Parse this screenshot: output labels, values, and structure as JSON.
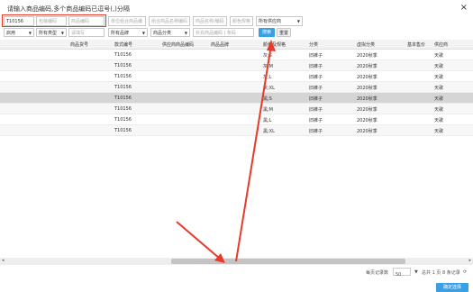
{
  "dialog": {
    "title": "请输入商品编码,多个商品编码已逗号(,)分隔",
    "close_icon": "×"
  },
  "filters": {
    "code_input_value": "T10156",
    "spec_code_placeholder": "包装编码",
    "product_code_placeholder": "商品编码",
    "fields": [
      "单位组合商品编码",
      "组合商品名称编码",
      "商品名称/编码",
      "颜色规格"
    ],
    "supplier_select": "所有供应商",
    "status_select": "启用",
    "all_types_select": "所有类型",
    "enterprise_placeholder": "请填写",
    "brand_select": "所有品牌",
    "category_select": "商品分类",
    "goods_search_placeholder": "补充商品编码 | 条码",
    "search_button": "搜索",
    "reset_button": "重置"
  },
  "table": {
    "headers": [
      "商品货号",
      "款式编号",
      "供应商商品编码",
      "商品品牌",
      "颜色及规格",
      "分类",
      "虚拟分类",
      "基本售价",
      "供应商"
    ],
    "rows": [
      {
        "style": "T10156",
        "color": "灰;S",
        "cat": "旧裤子",
        "vcat": "2020秋季",
        "supplier": "天歌"
      },
      {
        "style": "T10156",
        "color": "灰;M",
        "cat": "旧裤子",
        "vcat": "2020秋季",
        "supplier": "天歌"
      },
      {
        "style": "T10156",
        "color": "灰;L",
        "cat": "旧裤子",
        "vcat": "2020秋季",
        "supplier": "天歌"
      },
      {
        "style": "T10156",
        "color": "灰;XL",
        "cat": "旧裤子",
        "vcat": "2020秋季",
        "supplier": "天歌"
      },
      {
        "style": "T10156",
        "color": "黑;S",
        "cat": "旧裤子",
        "vcat": "2020秋季",
        "supplier": "天歌"
      },
      {
        "style": "T10156",
        "color": "黑;M",
        "cat": "旧裤子",
        "vcat": "2020秋季",
        "supplier": "天歌"
      },
      {
        "style": "T10156",
        "color": "黑;L",
        "cat": "旧裤子",
        "vcat": "2020秋季",
        "supplier": "天歌"
      },
      {
        "style": "T10156",
        "color": "黑;XL",
        "cat": "旧裤子",
        "vcat": "2020秋季",
        "supplier": "天歌"
      }
    ]
  },
  "pager": {
    "per_page_label": "每页记录数",
    "per_page": "50",
    "summary": "总共 1 页 8 条记录",
    "refresh_icon": "⟳"
  },
  "confirm_button": "确定选择",
  "colors": {
    "accent": "#3aa0e6",
    "annotation": "#e8392b"
  }
}
